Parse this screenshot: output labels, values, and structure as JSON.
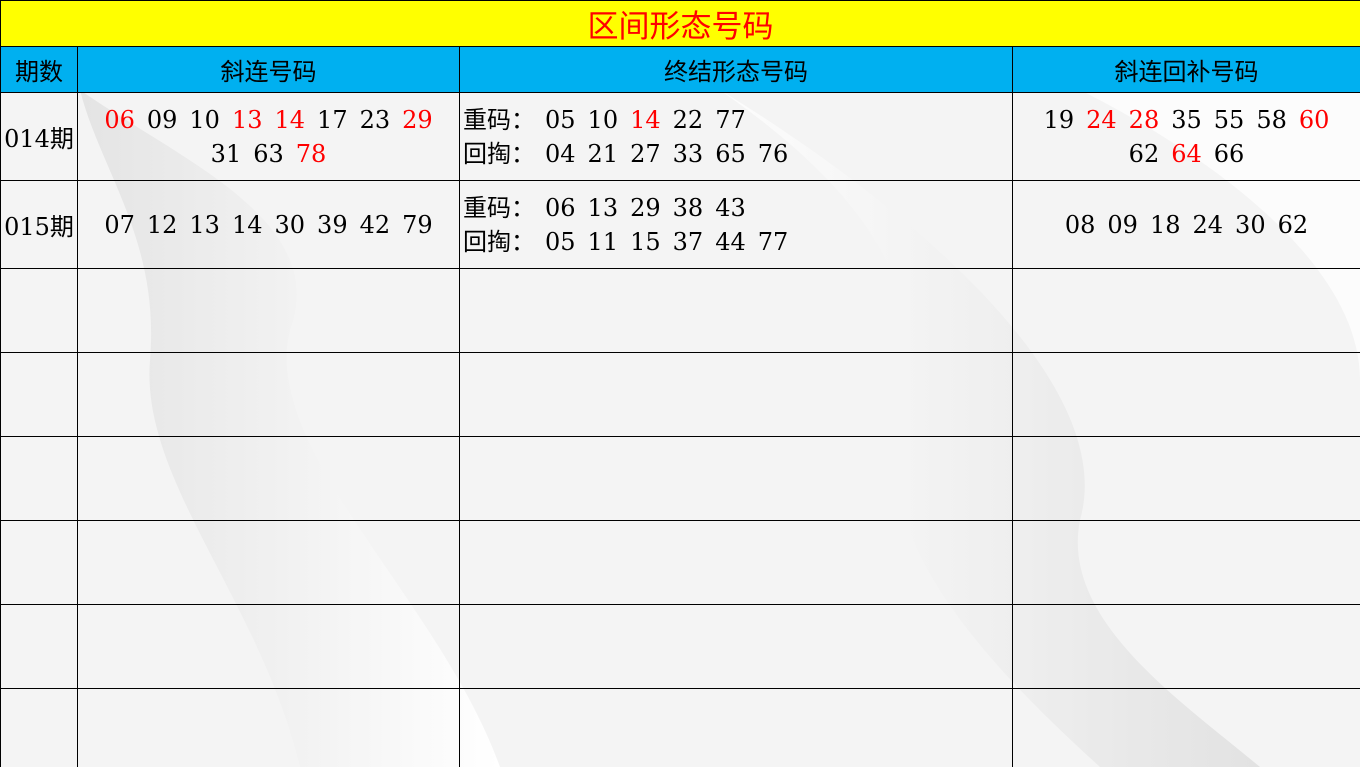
{
  "title": "区间形态号码",
  "headers": {
    "period": "期数",
    "diagonal": "斜连号码",
    "final_form": "终结形态号码",
    "supplement": "斜连回补号码"
  },
  "colors": {
    "title_bg": "#ffff00",
    "title_text": "#ff0000",
    "header_bg": "#00b0f0",
    "highlight": "#ff0000",
    "grid": "#000000"
  },
  "rows": [
    {
      "period": "014期",
      "diagonal": [
        {
          "n": "06",
          "red": true
        },
        {
          "n": "09",
          "red": false
        },
        {
          "n": "10",
          "red": false
        },
        {
          "n": "13",
          "red": true
        },
        {
          "n": "14",
          "red": true
        },
        {
          "n": "17",
          "red": false
        },
        {
          "n": "23",
          "red": false
        },
        {
          "n": "29",
          "red": true
        },
        {
          "n": "31",
          "red": false
        },
        {
          "n": "63",
          "red": false
        },
        {
          "n": "78",
          "red": true
        }
      ],
      "repeat_label": "重码：",
      "repeat": [
        {
          "n": "05",
          "red": false
        },
        {
          "n": "10",
          "red": false
        },
        {
          "n": "14",
          "red": true
        },
        {
          "n": "22",
          "red": false
        },
        {
          "n": "77",
          "red": false
        }
      ],
      "dig_label": "回掏：",
      "dig": [
        {
          "n": "04",
          "red": false
        },
        {
          "n": "21",
          "red": false
        },
        {
          "n": "27",
          "red": false
        },
        {
          "n": "33",
          "red": false
        },
        {
          "n": "65",
          "red": false
        },
        {
          "n": "76",
          "red": false
        }
      ],
      "supplement": [
        {
          "n": "19",
          "red": false
        },
        {
          "n": "24",
          "red": true
        },
        {
          "n": "28",
          "red": true
        },
        {
          "n": "35",
          "red": false
        },
        {
          "n": "55",
          "red": false
        },
        {
          "n": "58",
          "red": false
        },
        {
          "n": "60",
          "red": true
        },
        {
          "n": "62",
          "red": false
        },
        {
          "n": "64",
          "red": true
        },
        {
          "n": "66",
          "red": false
        }
      ]
    },
    {
      "period": "015期",
      "diagonal": [
        {
          "n": "07",
          "red": false
        },
        {
          "n": "12",
          "red": false
        },
        {
          "n": "13",
          "red": false
        },
        {
          "n": "14",
          "red": false
        },
        {
          "n": "30",
          "red": false
        },
        {
          "n": "39",
          "red": false
        },
        {
          "n": "42",
          "red": false
        },
        {
          "n": "79",
          "red": false
        }
      ],
      "repeat_label": "重码：",
      "repeat": [
        {
          "n": "06",
          "red": false
        },
        {
          "n": "13",
          "red": false
        },
        {
          "n": "29",
          "red": false
        },
        {
          "n": "38",
          "red": false
        },
        {
          "n": "43",
          "red": false
        }
      ],
      "dig_label": "回掏：",
      "dig": [
        {
          "n": "05",
          "red": false
        },
        {
          "n": "11",
          "red": false
        },
        {
          "n": "15",
          "red": false
        },
        {
          "n": "37",
          "red": false
        },
        {
          "n": "44",
          "red": false
        },
        {
          "n": "77",
          "red": false
        }
      ],
      "supplement": [
        {
          "n": "08",
          "red": false
        },
        {
          "n": "09",
          "red": false
        },
        {
          "n": "18",
          "red": false
        },
        {
          "n": "24",
          "red": false
        },
        {
          "n": "30",
          "red": false
        },
        {
          "n": "62",
          "red": false
        }
      ]
    }
  ]
}
